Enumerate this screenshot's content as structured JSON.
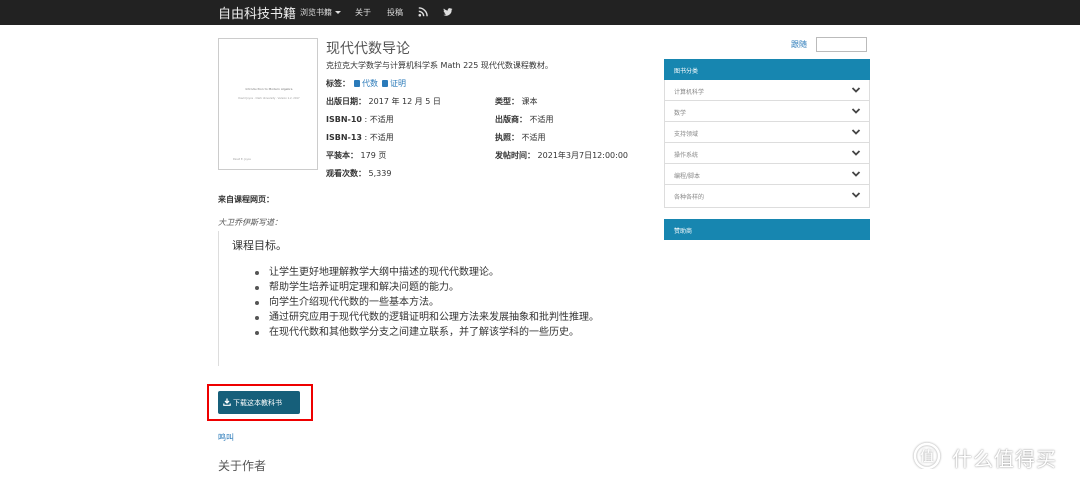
{
  "navbar": {
    "brand": "自由科技书籍",
    "browse": "浏览书籍",
    "about": "关于",
    "contribute": "投稿",
    "icons": [
      "rss-icon",
      "twitter-icon"
    ]
  },
  "book": {
    "title": "现代代数导论",
    "description": "克拉克大学数学与计算机科学系 Math 225 现代代数课程教材。",
    "cover": {
      "title": "Introduction to Modern Algebra",
      "subtitle": "David Joyce · Clark University · Version 1.2, 2017",
      "author": "David E. Joyce"
    },
    "tags_label": "标签：",
    "tags": [
      "代数",
      "证明"
    ],
    "published_label": "出版日期：",
    "published_value": "2017 年 12 月 5 日",
    "type_label": "类型：",
    "type_value": "课本",
    "isbn10_label": "ISBN-10",
    "isbn10_value": " : 不适用",
    "publisher_label": "出版商：",
    "publisher_value": "不适用",
    "isbn13_label": "ISBN-13",
    "isbn13_value": " : 不适用",
    "license_label": "执照：",
    "license_value": "不适用",
    "paperback_label": "平装本：",
    "paperback_value": "179 页",
    "posted_label": "发帖时间：",
    "posted_value": "2021年3月7日12:00:00",
    "views_label": "观看次数：",
    "views_value": "5,339"
  },
  "follow": {
    "label": "跟随"
  },
  "sidebar": {
    "categories_title": "图书分类",
    "categories": [
      "计算机科学",
      "数学",
      "支持领域",
      "操作系统",
      "编程/脚本",
      "各种各样的"
    ],
    "sponsors_title": "赞助商"
  },
  "content": {
    "from_label": "来自课程网页：",
    "author_wrote": "大卫乔伊斯写道：",
    "goals_title": "课程目标。",
    "goals": [
      "让学生更好地理解教学大纲中描述的现代代数理论。",
      "帮助学生培养证明定理和解决问题的能力。",
      "向学生介绍现代代数的一些基本方法。",
      "通过研究应用于现代代数的逻辑证明和公理方法来发展抽象和批判性推理。",
      "在现代代数和其他数学分支之间建立联系，并了解该学科的一些历史。"
    ]
  },
  "download": {
    "label": "下载这本教科书"
  },
  "woops": "鸣叫",
  "about_author": "关于作者",
  "watermark": {
    "text": "什么值得买"
  },
  "colors": {
    "navbar": "#222222",
    "accent": "#1786b0",
    "button": "#165f7a",
    "link": "#2a7ab9",
    "highlight_box": "#ee0000"
  }
}
